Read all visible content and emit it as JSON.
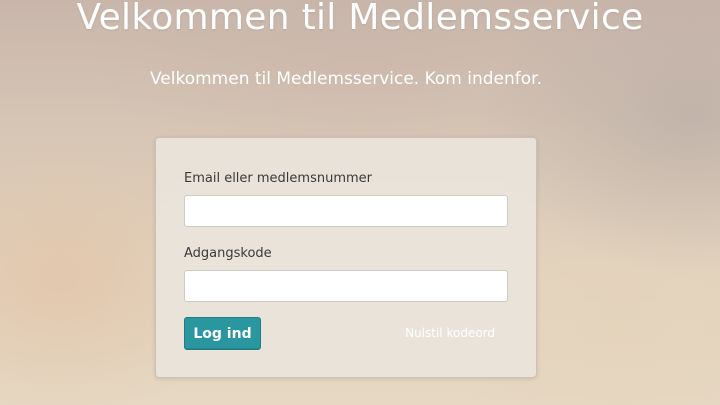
{
  "page": {
    "title": "Velkommen til Medlemsservice",
    "subtitle": "Velkommen til Medlemsservice. Kom indenfor."
  },
  "login_form": {
    "email_label": "Email eller medlemsnummer",
    "email_value": "",
    "password_label": "Adgangskode",
    "password_value": "",
    "submit_label": "Log ind",
    "reset_link_label": "Nulstil kodeord"
  },
  "colors": {
    "accent": "#2a97a0",
    "card_background": "#e9e4dc",
    "heading_text": "#ffffff"
  }
}
